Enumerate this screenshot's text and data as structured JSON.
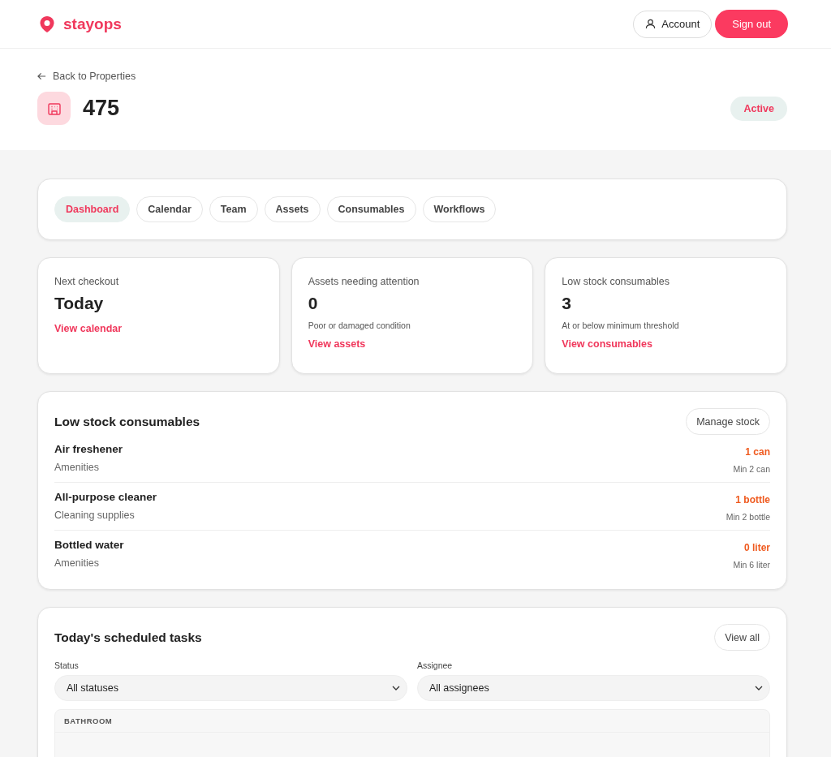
{
  "header": {
    "brand": "stayops",
    "account": "Account",
    "sign_out": "Sign out"
  },
  "property": {
    "back": "Back to Properties",
    "name": "475",
    "status": "Active"
  },
  "tabs": [
    {
      "label": "Dashboard",
      "selected": true
    },
    {
      "label": "Calendar",
      "selected": false
    },
    {
      "label": "Team",
      "selected": false
    },
    {
      "label": "Assets",
      "selected": false
    },
    {
      "label": "Consumables",
      "selected": false
    },
    {
      "label": "Workflows",
      "selected": false
    }
  ],
  "stats": [
    {
      "label": "Next checkout",
      "value": "Today",
      "link": "View calendar"
    },
    {
      "label": "Assets needing attention",
      "value": "0",
      "note": "Poor or damaged condition",
      "link": "View assets"
    },
    {
      "label": "Low stock consumables",
      "value": "3",
      "note": "At or below minimum threshold",
      "link": "View consumables"
    }
  ],
  "low_stock": {
    "title": "Low stock consumables",
    "button": "Manage stock",
    "items": [
      {
        "name": "Air freshener",
        "category": "Amenities",
        "quantity": "1 can",
        "minimum": "Min 2 can"
      },
      {
        "name": "All-purpose cleaner",
        "category": "Cleaning supplies",
        "quantity": "1 bottle",
        "minimum": "Min 2 bottle"
      },
      {
        "name": "Bottled water",
        "category": "Amenities",
        "quantity": "0 liter",
        "minimum": "Min 6 liter"
      }
    ]
  },
  "tasks": {
    "title": "Today's scheduled tasks",
    "button": "View all",
    "filters": [
      {
        "label": "Status",
        "value": "All statuses"
      },
      {
        "label": "Assignee",
        "value": "All assignees"
      }
    ],
    "groups": [
      {
        "name": "BATHROOM"
      }
    ]
  }
}
